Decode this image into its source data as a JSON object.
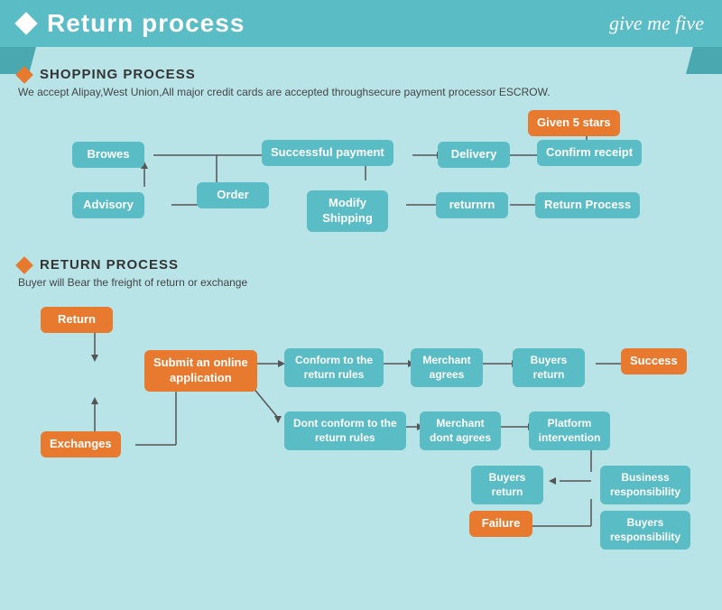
{
  "header": {
    "title": "Return process",
    "logo": "give me five"
  },
  "shopping_section": {
    "title": "SHOPPING PROCESS",
    "subtitle": "We accept Alipay,West Union,All major credit cards are accepted throughsecure payment processor ESCROW.",
    "boxes": {
      "browes": "Browes",
      "order": "Order",
      "advisory": "Advisory",
      "modify_shipping": "Modify\nShipping",
      "successful_payment": "Successful\npayment",
      "delivery": "Delivery",
      "confirm_receipt": "Confirm\nreceipt",
      "given_5_stars": "Given 5 stars",
      "returnrn": "returnrn",
      "return_process": "Return Process"
    }
  },
  "return_section": {
    "title": "RETURN PROCESS",
    "subtitle": "Buyer will Bear the freight of return or exchange",
    "boxes": {
      "return": "Return",
      "exchanges": "Exchanges",
      "submit_online": "Submit an online\napplication",
      "conform_rules": "Conform to the\nreturn rules",
      "dont_conform_rules": "Dont conform to the\nreturn rules",
      "merchant_agrees": "Merchant\nagrees",
      "merchant_dont_agrees": "Merchant\ndont agrees",
      "buyers_return1": "Buyers\nreturn",
      "buyers_return2": "Buyers\nreturn",
      "platform_intervention": "Platform\nintervention",
      "success": "Success",
      "failure": "Failure",
      "business_responsibility": "Business\nresponsibility",
      "buyers_responsibility": "Buyers\nresponsibility"
    }
  }
}
